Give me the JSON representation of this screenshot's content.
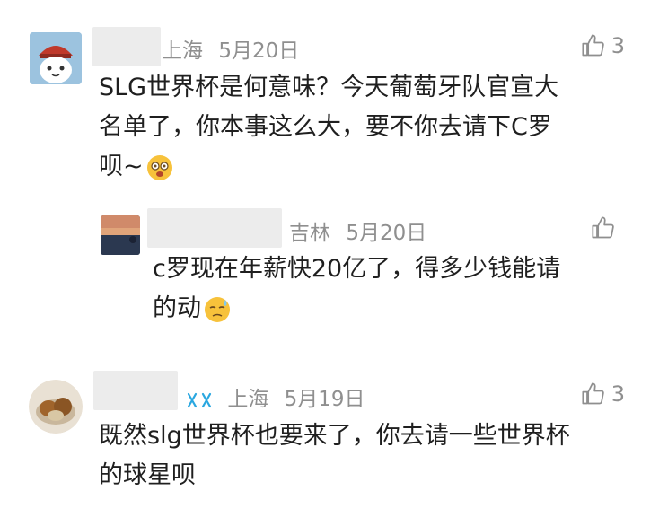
{
  "comments": [
    {
      "location": "上海",
      "date": "5月20日",
      "likes": "3",
      "lines": [
        "SLG世界杯是何意味？今天葡萄牙队官宣大",
        "名单了，你本事这么大，要不你去请下C罗",
        "呗~"
      ],
      "avatar_icon": "cartoon-cat-avatar",
      "emoji_icon": "dizzy-face-emoji"
    },
    {
      "location": "吉林",
      "date": "5月20日",
      "likes": "",
      "lines": [
        "c罗现在年薪快20亿了，得多少钱能请",
        "的动"
      ],
      "avatar_icon": "sunset-photo-avatar",
      "emoji_icon": "sweat-face-emoji"
    },
    {
      "location": "上海",
      "date": "5月19日",
      "likes": "3",
      "lines": [
        "既然slg世界杯也要来了，你去请一些世界杯",
        "的球星呗"
      ],
      "avatar_icon": "food-photo-avatar",
      "badge_icon": "infinity-badge-icon"
    }
  ],
  "colors": {
    "meta": "#8f8f8f",
    "text": "#1f1f1f",
    "badge": "#2aa7e0"
  }
}
